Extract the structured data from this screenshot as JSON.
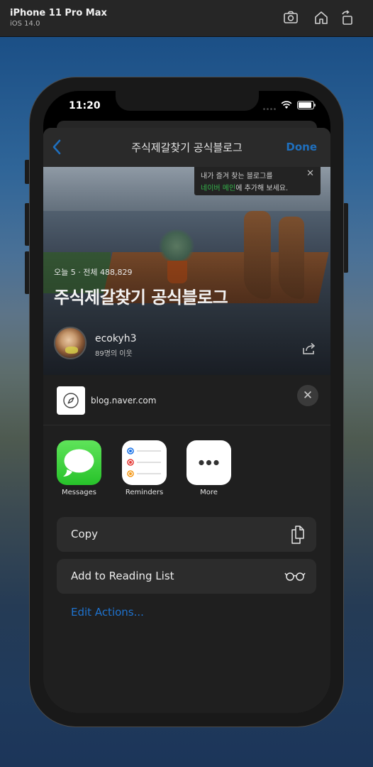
{
  "device": {
    "name": "iPhone 11 Pro Max",
    "os": "iOS 14.0"
  },
  "toolbar": {
    "icons": [
      "screenshot-icon",
      "home-icon",
      "rotate-icon"
    ]
  },
  "status": {
    "time": "11:20"
  },
  "nav": {
    "title": "주식제갈찾기 공식블로그",
    "done": "Done"
  },
  "tooltip": {
    "line1": "내가 즐겨 찾는 블로그를",
    "line2_highlight": "네이버 메인",
    "line2_rest": "에 추가해 보세요."
  },
  "hero": {
    "stats": "오늘 5 · 전체 488,829",
    "blog_title": "주식제갈찾기 공식블로그",
    "username": "ecokyh3",
    "neighbors": "89명의 이웃"
  },
  "share": {
    "url": "blog.naver.com",
    "apps": [
      {
        "label": "Messages",
        "icon": "messages-icon"
      },
      {
        "label": "Reminders",
        "icon": "reminders-icon"
      },
      {
        "label": "More",
        "icon": "more-icon"
      }
    ],
    "actions": [
      {
        "label": "Copy",
        "icon": "copy-icon"
      },
      {
        "label": "Add to Reading List",
        "icon": "glasses-icon"
      }
    ],
    "edit_actions": "Edit Actions..."
  },
  "colors": {
    "accent": "#1f73cf",
    "naver_green": "#34b34a",
    "messages_green": "#27c22a"
  }
}
